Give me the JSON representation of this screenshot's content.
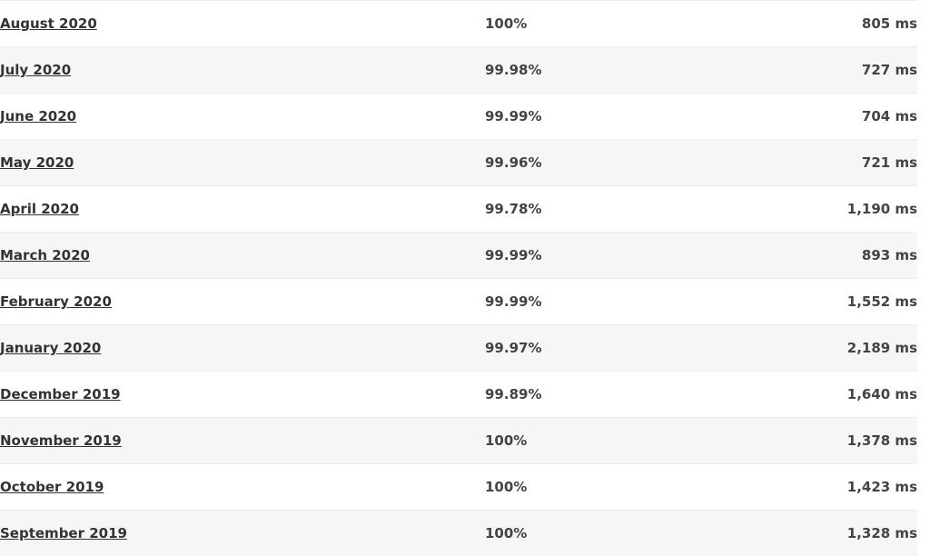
{
  "table": {
    "columns": [
      {
        "key": "month",
        "name": "month-column"
      },
      {
        "key": "uptime",
        "name": "uptime-column"
      },
      {
        "key": "response",
        "name": "response-time-column"
      }
    ],
    "rows": [
      {
        "month": "August 2020",
        "uptime": "100%",
        "response": "805 ms"
      },
      {
        "month": "July 2020",
        "uptime": "99.98%",
        "response": "727 ms"
      },
      {
        "month": "June 2020",
        "uptime": "99.99%",
        "response": "704 ms"
      },
      {
        "month": "May 2020",
        "uptime": "99.96%",
        "response": "721 ms"
      },
      {
        "month": "April 2020",
        "uptime": "99.78%",
        "response": "1,190 ms"
      },
      {
        "month": "March 2020",
        "uptime": "99.99%",
        "response": "893 ms"
      },
      {
        "month": "February 2020",
        "uptime": "99.99%",
        "response": "1,552 ms"
      },
      {
        "month": "January 2020",
        "uptime": "99.97%",
        "response": "2,189 ms"
      },
      {
        "month": "December 2019",
        "uptime": "99.89%",
        "response": "1,640 ms"
      },
      {
        "month": "November 2019",
        "uptime": "100%",
        "response": "1,378 ms"
      },
      {
        "month": "October 2019",
        "uptime": "100%",
        "response": "1,423 ms"
      },
      {
        "month": "September 2019",
        "uptime": "100%",
        "response": "1,328 ms"
      }
    ]
  },
  "colors": {
    "row_odd_background": "#ffffff",
    "row_even_background": "#f6f6f6",
    "row_border": "#ececec",
    "link_text": "#333333",
    "value_text": "#444444",
    "page_background": "#ffffff"
  }
}
